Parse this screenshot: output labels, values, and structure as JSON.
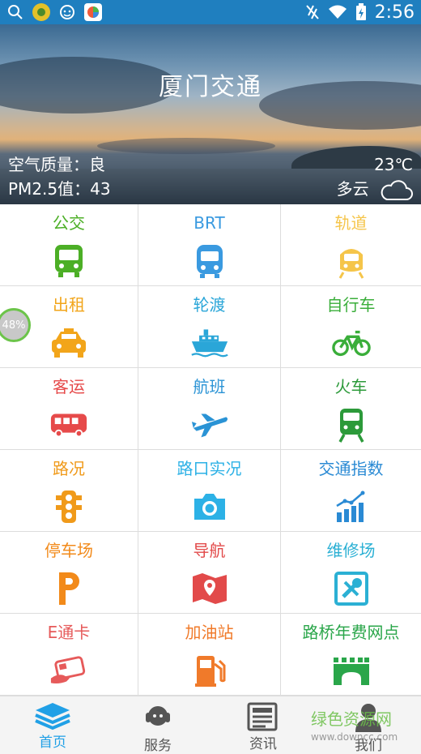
{
  "status_bar": {
    "time": "2:56"
  },
  "hero": {
    "title": "厦门交通",
    "air_quality": "空气质量：良",
    "pm25": "PM2.5值：43",
    "temperature": "23℃",
    "weather": "多云"
  },
  "progress_badge": "48%",
  "grid": [
    {
      "label": "公交",
      "icon": "bus-icon",
      "color": "#4caf26"
    },
    {
      "label": "BRT",
      "icon": "brt-bus-icon",
      "color": "#3a9ae0"
    },
    {
      "label": "轨道",
      "icon": "metro-icon",
      "color": "#f5c54a"
    },
    {
      "label": "出租",
      "icon": "taxi-icon",
      "color": "#f2a51a"
    },
    {
      "label": "轮渡",
      "icon": "ferry-icon",
      "color": "#2aa6d8"
    },
    {
      "label": "自行车",
      "icon": "bicycle-icon",
      "color": "#3aae3a"
    },
    {
      "label": "客运",
      "icon": "coach-icon",
      "color": "#e64a4a"
    },
    {
      "label": "航班",
      "icon": "airplane-icon",
      "color": "#2a93d5"
    },
    {
      "label": "火车",
      "icon": "train-icon",
      "color": "#2c9a3a"
    },
    {
      "label": "路况",
      "icon": "traffic-light-icon",
      "color": "#f09a1a"
    },
    {
      "label": "路口实况",
      "icon": "camera-icon",
      "color": "#2cb1e6"
    },
    {
      "label": "交通指数",
      "icon": "chart-icon",
      "color": "#2a8ad4"
    },
    {
      "label": "停车场",
      "icon": "parking-icon",
      "color": "#f28a1a"
    },
    {
      "label": "导航",
      "icon": "map-icon",
      "color": "#e24a4a"
    },
    {
      "label": "维修场",
      "icon": "tools-icon",
      "color": "#2bb0d4"
    },
    {
      "label": "E通卡",
      "icon": "card-icon",
      "color": "#e65a5a"
    },
    {
      "label": "加油站",
      "icon": "gas-station-icon",
      "color": "#f07a2a"
    },
    {
      "label": "路桥年费网点",
      "icon": "bridge-icon",
      "color": "#2aa64a"
    }
  ],
  "tabs": [
    {
      "label": "首页",
      "icon": "home-layers-icon"
    },
    {
      "label": "服务",
      "icon": "service-agent-icon"
    },
    {
      "label": "资讯",
      "icon": "news-icon"
    },
    {
      "label": "我们",
      "icon": "user-icon"
    }
  ],
  "watermark": {
    "title": "绿色资源网",
    "url": "www.downcc.com"
  }
}
